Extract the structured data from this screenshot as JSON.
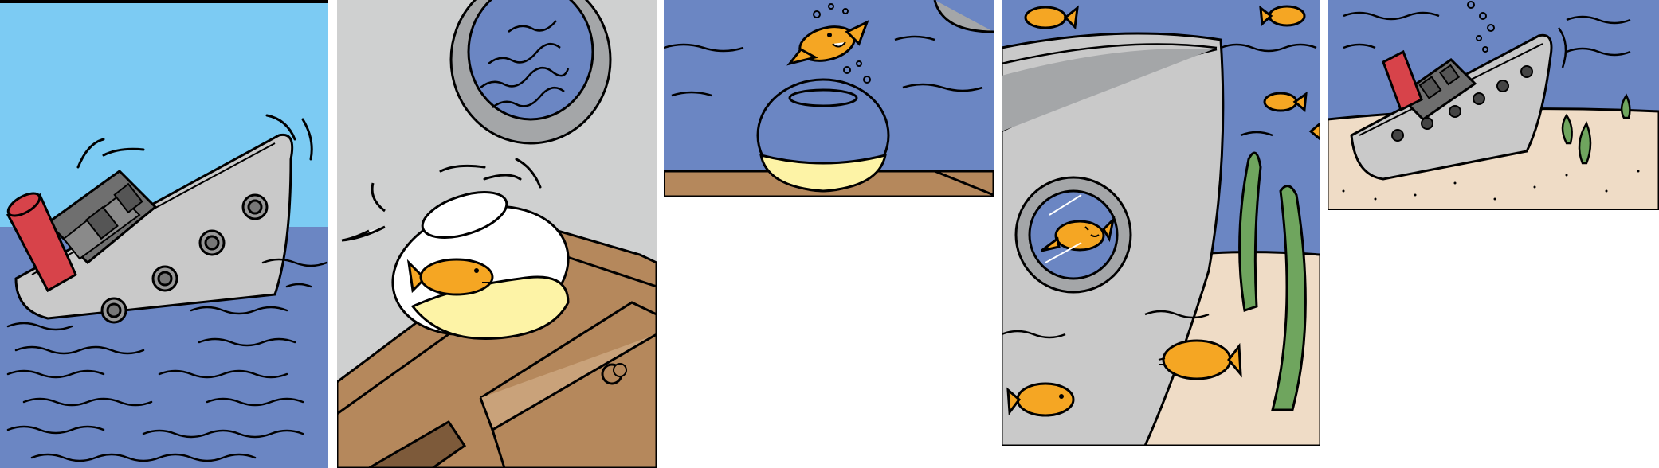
{
  "comic": {
    "colors": {
      "sky": "#7ccbf3",
      "sea": "#6b86c3",
      "wall": "#cfd0d0",
      "hull": "#c9c9c9",
      "cabin": "#6f6f6f",
      "funnel": "#d7434a",
      "fish": "#f5a623",
      "sand_bowl": "#fdf3a6",
      "wood": "#b5885c",
      "seabed": "#efdcc6",
      "kelp": "#6fa55e",
      "outline": "#000000"
    },
    "panels": [
      {
        "scene": "boat-sinking-in-waves"
      },
      {
        "scene": "goldfish-bowl-tipping-on-dresser"
      },
      {
        "scene": "goldfish-jumping-out-of-bowl"
      },
      {
        "scene": "goldfish-inside-porthole-underwater"
      },
      {
        "scene": "boat-resting-on-seabed"
      }
    ]
  }
}
